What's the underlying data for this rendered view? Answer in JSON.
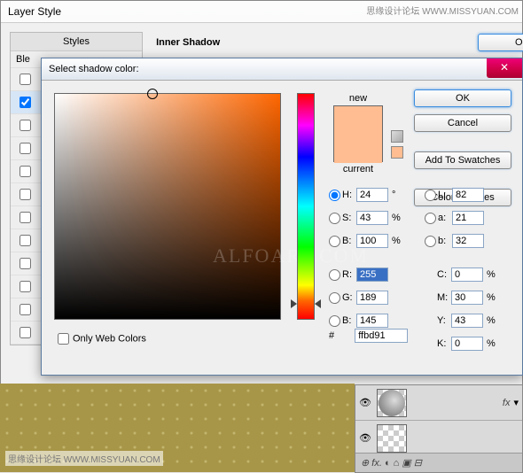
{
  "watermark_top": "思缘设计论坛 WWW.MISSYUAN.COM",
  "watermark_bot": "思缘设计论坛 WWW.MISSYUAN.COM",
  "alfo": "ALFOART.COM",
  "layerStyle": {
    "title": "Layer Style",
    "stylesHeader": "Styles",
    "blendRow": "Ble",
    "section": "Inner Shadow",
    "ok": "OK"
  },
  "picker": {
    "title": "Select shadow color:",
    "new": "new",
    "current": "current",
    "ok": "OK",
    "cancel": "Cancel",
    "addSwatch": "Add To Swatches",
    "colorLib": "Color Libraries",
    "H": "24",
    "Hu": "°",
    "S": "43",
    "Su": "%",
    "Bv": "100",
    "Bu": "%",
    "R": "255",
    "G": "189",
    "Bl": "145",
    "L": "82",
    "a": "21",
    "b": "32",
    "C": "0",
    "Cu": "%",
    "M": "30",
    "Mu": "%",
    "Y": "43",
    "Yu": "%",
    "K": "0",
    "Ku": "%",
    "hexLabel": "#",
    "hex": "ffbd91",
    "owc": "Only Web Colors"
  },
  "layers": {
    "fx": "fx",
    "icons": "⊕  fx.  ◐  ⌂  ▣  ⊟"
  }
}
